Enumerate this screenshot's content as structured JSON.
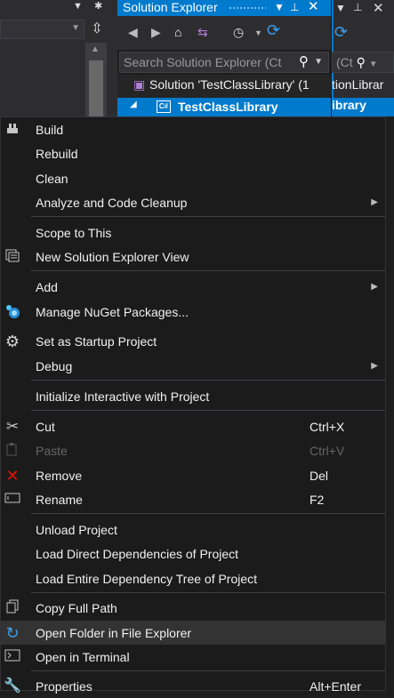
{
  "solution_explorer": {
    "title": "Solution Explorer",
    "search_placeholder": "Search Solution Explorer (Ct",
    "solution_label": "Solution 'TestClassLibrary' (1",
    "project_label": "TestClassLibrary",
    "project_icon_text": "C#"
  },
  "right_pane": {
    "search_fragment": "(Ct",
    "tree_fragment": "tionLibrar",
    "project_fragment": "ibrary"
  },
  "menu": {
    "items": [
      {
        "label": "Build",
        "icon": "build-icon"
      },
      {
        "label": "Rebuild"
      },
      {
        "label": "Clean"
      },
      {
        "label": "Analyze and Code Cleanup",
        "submenu": true
      },
      {
        "label": "Scope to This"
      },
      {
        "label": "New Solution Explorer View",
        "icon": "new-view-icon"
      },
      {
        "label": "Add",
        "submenu": true
      },
      {
        "label": "Manage NuGet Packages...",
        "icon": "nuget-icon"
      },
      {
        "label": "Set as Startup Project",
        "icon": "gear-icon"
      },
      {
        "label": "Debug",
        "submenu": true
      },
      {
        "label": "Initialize Interactive with Project"
      },
      {
        "label": "Cut",
        "shortcut": "Ctrl+X",
        "icon": "scissors-icon"
      },
      {
        "label": "Paste",
        "shortcut": "Ctrl+V",
        "icon": "paste-icon",
        "disabled": true
      },
      {
        "label": "Remove",
        "shortcut": "Del",
        "icon": "close-icon"
      },
      {
        "label": "Rename",
        "shortcut": "F2",
        "icon": "rename-icon"
      },
      {
        "label": "Unload Project"
      },
      {
        "label": "Load Direct Dependencies of Project"
      },
      {
        "label": "Load Entire Dependency Tree of Project"
      },
      {
        "label": "Copy Full Path",
        "icon": "copy-icon"
      },
      {
        "label": "Open Folder in File Explorer",
        "icon": "refresh-arrow-icon",
        "hovered": true
      },
      {
        "label": "Open in Terminal",
        "icon": "terminal-icon"
      },
      {
        "label": "Properties",
        "shortcut": "Alt+Enter",
        "icon": "wrench-icon"
      }
    ]
  },
  "colors": {
    "accent": "#007acc",
    "menu_bg": "#1b1b1c",
    "hover_bg": "#333334",
    "remove_icon": "#e51400",
    "nuget_icon": "#4fc3f7"
  }
}
